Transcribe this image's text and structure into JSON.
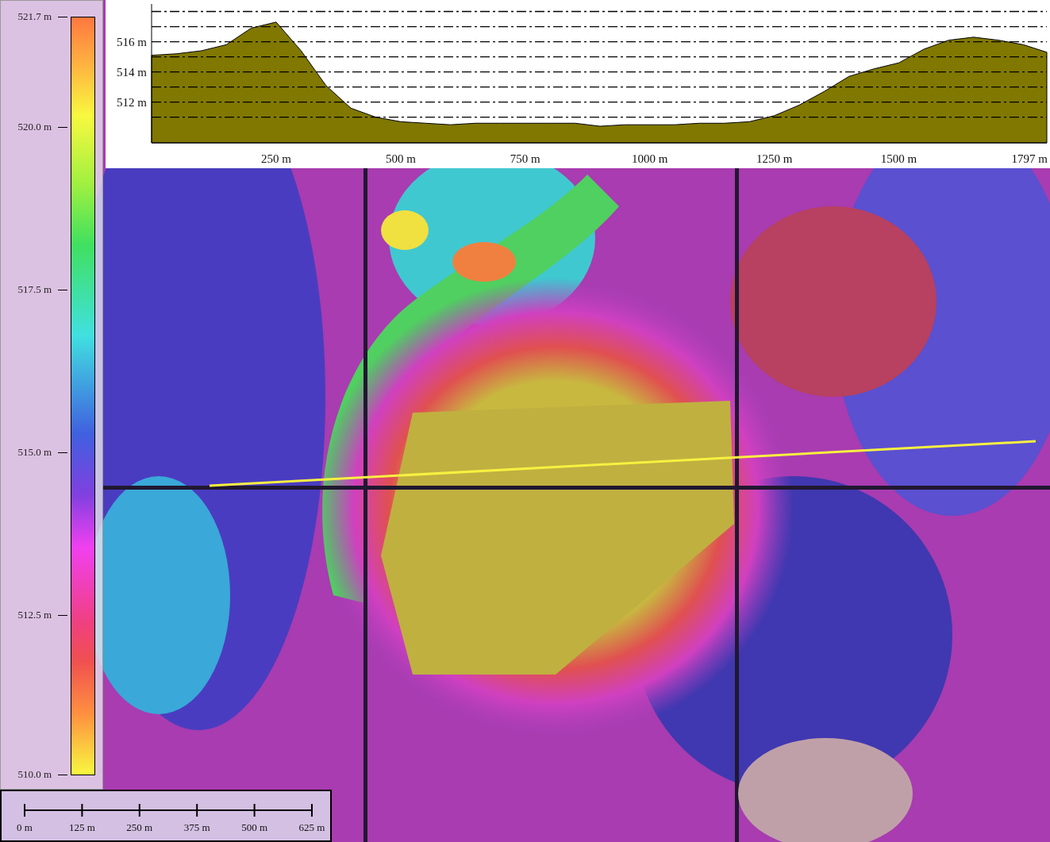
{
  "legend": {
    "labels": [
      "521.7 m",
      "520.0 m",
      "517.5 m",
      "515.0 m",
      "512.5 m",
      "510.0 m"
    ]
  },
  "profile": {
    "chart_data": {
      "type": "area",
      "xlim": [
        0,
        1797
      ],
      "ylim": [
        509.3,
        518.5
      ],
      "xticks": [
        {
          "value": 250,
          "label": "250 m"
        },
        {
          "value": 500,
          "label": "500 m"
        },
        {
          "value": 750,
          "label": "750 m"
        },
        {
          "value": 1000,
          "label": "1000 m"
        },
        {
          "value": 1250,
          "label": "1250 m"
        },
        {
          "value": 1500,
          "label": "1500 m"
        },
        {
          "value": 1797,
          "label": "1797 m"
        }
      ],
      "yticks": [
        {
          "value": 512,
          "label": "512 m"
        },
        {
          "value": 514,
          "label": "514 m"
        },
        {
          "value": 516,
          "label": "516 m"
        }
      ],
      "x": [
        0,
        50,
        100,
        150,
        200,
        250,
        300,
        350,
        400,
        450,
        500,
        550,
        600,
        650,
        700,
        750,
        800,
        850,
        900,
        950,
        1000,
        1050,
        1100,
        1150,
        1200,
        1250,
        1300,
        1350,
        1400,
        1450,
        1500,
        1550,
        1600,
        1650,
        1700,
        1750,
        1797
      ],
      "grid": true,
      "series": [
        {
          "color": "#807800",
          "values": [
            515.1,
            515.2,
            515.4,
            515.8,
            516.9,
            517.3,
            515.4,
            513.1,
            511.6,
            511.0,
            510.7,
            510.6,
            510.5,
            510.6,
            510.6,
            510.6,
            510.6,
            510.6,
            510.4,
            510.5,
            510.5,
            510.5,
            510.6,
            510.6,
            510.7,
            511.1,
            511.8,
            512.7,
            513.7,
            514.2,
            514.6,
            515.5,
            516.1,
            516.3,
            516.1,
            515.8,
            515.3
          ]
        }
      ]
    }
  },
  "scale_bar": {
    "labels": [
      "0 m",
      "125 m",
      "250 m",
      "375 m",
      "500 m",
      "625 m"
    ]
  }
}
